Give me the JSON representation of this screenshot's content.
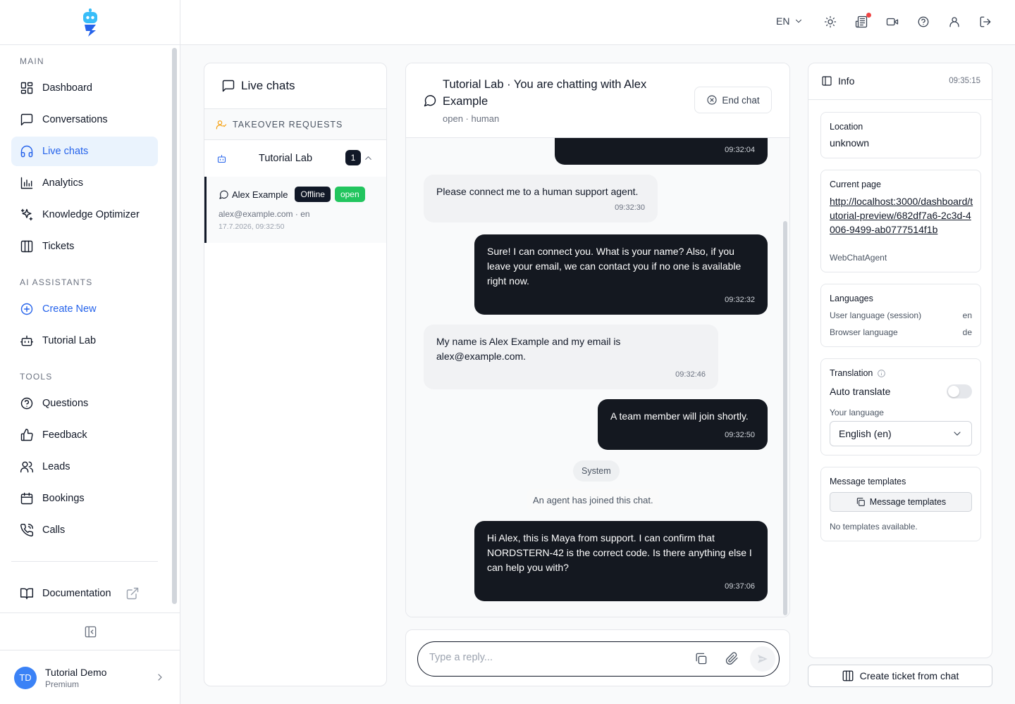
{
  "sidebar": {
    "sections": {
      "main": "MAIN",
      "ai": "AI ASSISTANTS",
      "tools": "TOOLS"
    },
    "items": {
      "dashboard": "Dashboard",
      "conversations": "Conversations",
      "live_chats": "Live chats",
      "analytics": "Analytics",
      "knowledge": "Knowledge Optimizer",
      "tickets": "Tickets",
      "create_new": "Create New",
      "tutorial_lab": "Tutorial Lab",
      "questions": "Questions",
      "feedback": "Feedback",
      "leads": "Leads",
      "bookings": "Bookings",
      "calls": "Calls",
      "documentation": "Documentation"
    },
    "user": {
      "initials": "TD",
      "name": "Tutorial Demo",
      "plan": "Premium"
    }
  },
  "topbar": {
    "language": "EN",
    "accent_dot_color": "#ef4444"
  },
  "list": {
    "title": "Live chats",
    "takeover": "TAKEOVER REQUESTS",
    "group": {
      "name": "Tutorial Lab",
      "count": "1"
    },
    "chat": {
      "name": "Alex Example",
      "status_badge": "Offline",
      "state_badge": "open",
      "meta": "alex@example.com · en",
      "date": "17.7.2026, 09:32:50"
    }
  },
  "chat": {
    "title": "Tutorial Lab · You are chatting with Alex Example",
    "subtitle": "open · human",
    "end_label": "End chat",
    "messages": [
      {
        "dir": "out",
        "text": "",
        "time": "09:32:04"
      },
      {
        "dir": "in",
        "text": "Please connect me to a human support agent.",
        "time": "09:32:30"
      },
      {
        "dir": "out",
        "text": "Sure! I can connect you. What is your name? Also, if you leave your email, we can contact you if no one is available right now.",
        "time": "09:32:32"
      },
      {
        "dir": "in",
        "text": "My name is Alex Example and my email is alex@example.com.",
        "time": "09:32:46"
      },
      {
        "dir": "out",
        "text": "A team member will join shortly.",
        "time": "09:32:50"
      },
      {
        "dir": "out",
        "text": "Hi Alex, this is Maya from support. I can confirm that NORDSTERN-42 is the correct code. Is there anything else I can help you with?",
        "time": "09:37:06"
      }
    ],
    "system_label": "System",
    "system_text": "An agent has joined this chat.",
    "reply_placeholder": "Type a reply..."
  },
  "info": {
    "title": "Info",
    "time": "09:35:15",
    "location": {
      "label": "Location",
      "value": "unknown"
    },
    "current_page": {
      "label": "Current page",
      "url": "http://localhost:3000/dashboard/tutorial-preview/682df7a6-2c3d-4006-9499-ab0777514f1b",
      "agent": "WebChatAgent"
    },
    "languages": {
      "label": "Languages",
      "user_label": "User language (session)",
      "user_value": "en",
      "browser_label": "Browser language",
      "browser_value": "de"
    },
    "translation": {
      "label": "Translation",
      "auto_label": "Auto translate",
      "auto_enabled": false,
      "your_lang_label": "Your language",
      "your_lang_value": "English (en)"
    },
    "templates": {
      "label": "Message templates",
      "button": "Message templates",
      "empty": "No templates available."
    },
    "ticket_button": "Create ticket from chat"
  },
  "colors": {
    "brand": "#2563eb",
    "dark_bubble": "#141820",
    "open_badge": "#22c55e",
    "takeover_icon": "#f59e0b"
  }
}
